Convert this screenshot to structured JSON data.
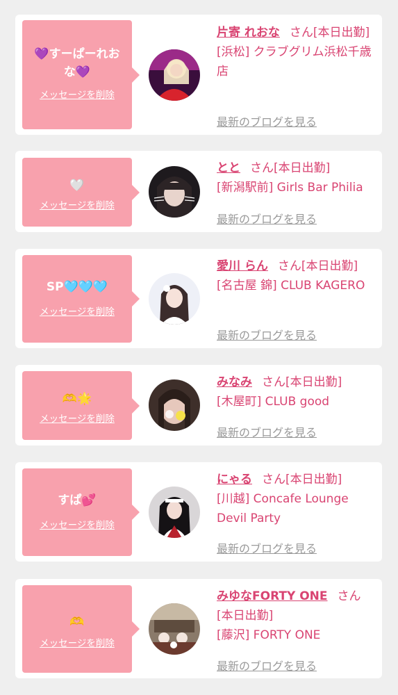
{
  "theme": {
    "accent": "#d94472",
    "bubble": "#f8a1ad",
    "background": "#efefef",
    "link_gray": "#9a9a9a"
  },
  "delete_label": "メッセージを削除",
  "blog_label": "最新のブログを見る",
  "san_label": "さん",
  "cards": [
    {
      "message": "💜すーぱーれおな💜",
      "name": "片寄 れおな",
      "status": "[本日出勤]",
      "shop": "[浜松] クラブグリム浜松千歳店"
    },
    {
      "message": "🤍",
      "name": "とと",
      "status": "[本日出勤]",
      "shop": "[新潟駅前] Girls Bar Philia"
    },
    {
      "message": "SP🩵🩵🩵",
      "name": "愛川 らん",
      "status": "[本日出勤]",
      "shop": "[名古屋 錦] CLUB KAGERO"
    },
    {
      "message": "🫶🌟",
      "name": "みなみ",
      "status": "[本日出勤]",
      "shop": "[木屋町] CLUB good"
    },
    {
      "message": "すぱ💕",
      "name": "にゃる",
      "status": "[本日出勤]",
      "shop": "[川越] Concafe Lounge Devil Party"
    },
    {
      "message": "🫶",
      "name": "みゆなFORTY ONE",
      "status": "[本日出勤]",
      "shop": "[藤沢] FORTY ONE"
    }
  ]
}
